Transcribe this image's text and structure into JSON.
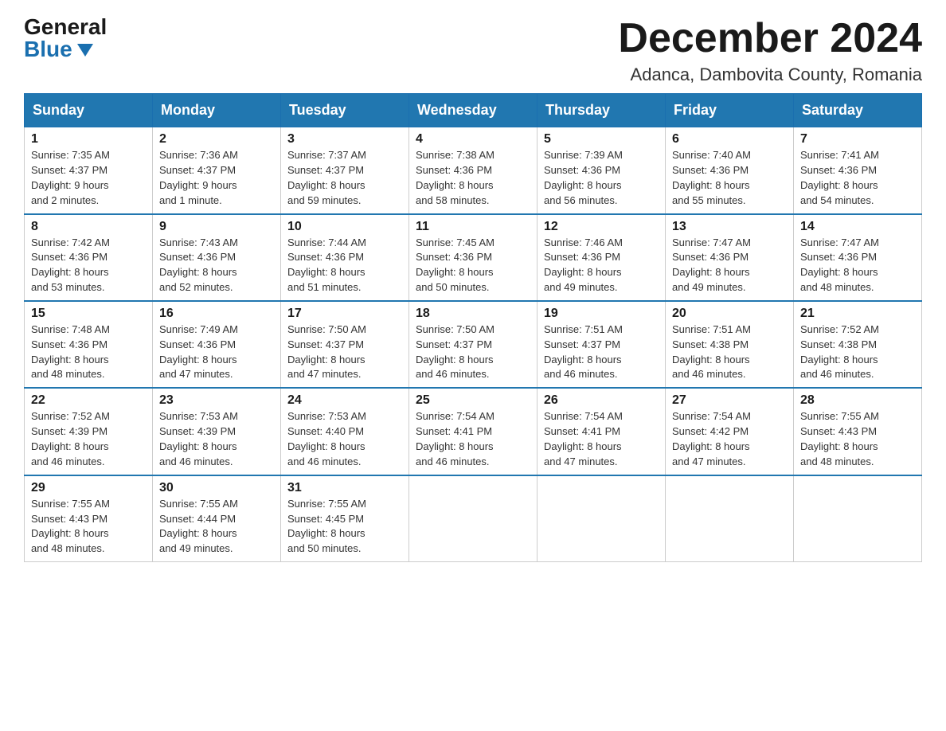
{
  "header": {
    "logo_general": "General",
    "logo_blue": "Blue",
    "month_title": "December 2024",
    "location": "Adanca, Dambovita County, Romania"
  },
  "days_of_week": [
    "Sunday",
    "Monday",
    "Tuesday",
    "Wednesday",
    "Thursday",
    "Friday",
    "Saturday"
  ],
  "weeks": [
    [
      {
        "day": "1",
        "sunrise": "7:35 AM",
        "sunset": "4:37 PM",
        "daylight": "9 hours and 2 minutes."
      },
      {
        "day": "2",
        "sunrise": "7:36 AM",
        "sunset": "4:37 PM",
        "daylight": "9 hours and 1 minute."
      },
      {
        "day": "3",
        "sunrise": "7:37 AM",
        "sunset": "4:37 PM",
        "daylight": "8 hours and 59 minutes."
      },
      {
        "day": "4",
        "sunrise": "7:38 AM",
        "sunset": "4:36 PM",
        "daylight": "8 hours and 58 minutes."
      },
      {
        "day": "5",
        "sunrise": "7:39 AM",
        "sunset": "4:36 PM",
        "daylight": "8 hours and 56 minutes."
      },
      {
        "day": "6",
        "sunrise": "7:40 AM",
        "sunset": "4:36 PM",
        "daylight": "8 hours and 55 minutes."
      },
      {
        "day": "7",
        "sunrise": "7:41 AM",
        "sunset": "4:36 PM",
        "daylight": "8 hours and 54 minutes."
      }
    ],
    [
      {
        "day": "8",
        "sunrise": "7:42 AM",
        "sunset": "4:36 PM",
        "daylight": "8 hours and 53 minutes."
      },
      {
        "day": "9",
        "sunrise": "7:43 AM",
        "sunset": "4:36 PM",
        "daylight": "8 hours and 52 minutes."
      },
      {
        "day": "10",
        "sunrise": "7:44 AM",
        "sunset": "4:36 PM",
        "daylight": "8 hours and 51 minutes."
      },
      {
        "day": "11",
        "sunrise": "7:45 AM",
        "sunset": "4:36 PM",
        "daylight": "8 hours and 50 minutes."
      },
      {
        "day": "12",
        "sunrise": "7:46 AM",
        "sunset": "4:36 PM",
        "daylight": "8 hours and 49 minutes."
      },
      {
        "day": "13",
        "sunrise": "7:47 AM",
        "sunset": "4:36 PM",
        "daylight": "8 hours and 49 minutes."
      },
      {
        "day": "14",
        "sunrise": "7:47 AM",
        "sunset": "4:36 PM",
        "daylight": "8 hours and 48 minutes."
      }
    ],
    [
      {
        "day": "15",
        "sunrise": "7:48 AM",
        "sunset": "4:36 PM",
        "daylight": "8 hours and 48 minutes."
      },
      {
        "day": "16",
        "sunrise": "7:49 AM",
        "sunset": "4:36 PM",
        "daylight": "8 hours and 47 minutes."
      },
      {
        "day": "17",
        "sunrise": "7:50 AM",
        "sunset": "4:37 PM",
        "daylight": "8 hours and 47 minutes."
      },
      {
        "day": "18",
        "sunrise": "7:50 AM",
        "sunset": "4:37 PM",
        "daylight": "8 hours and 46 minutes."
      },
      {
        "day": "19",
        "sunrise": "7:51 AM",
        "sunset": "4:37 PM",
        "daylight": "8 hours and 46 minutes."
      },
      {
        "day": "20",
        "sunrise": "7:51 AM",
        "sunset": "4:38 PM",
        "daylight": "8 hours and 46 minutes."
      },
      {
        "day": "21",
        "sunrise": "7:52 AM",
        "sunset": "4:38 PM",
        "daylight": "8 hours and 46 minutes."
      }
    ],
    [
      {
        "day": "22",
        "sunrise": "7:52 AM",
        "sunset": "4:39 PM",
        "daylight": "8 hours and 46 minutes."
      },
      {
        "day": "23",
        "sunrise": "7:53 AM",
        "sunset": "4:39 PM",
        "daylight": "8 hours and 46 minutes."
      },
      {
        "day": "24",
        "sunrise": "7:53 AM",
        "sunset": "4:40 PM",
        "daylight": "8 hours and 46 minutes."
      },
      {
        "day": "25",
        "sunrise": "7:54 AM",
        "sunset": "4:41 PM",
        "daylight": "8 hours and 46 minutes."
      },
      {
        "day": "26",
        "sunrise": "7:54 AM",
        "sunset": "4:41 PM",
        "daylight": "8 hours and 47 minutes."
      },
      {
        "day": "27",
        "sunrise": "7:54 AM",
        "sunset": "4:42 PM",
        "daylight": "8 hours and 47 minutes."
      },
      {
        "day": "28",
        "sunrise": "7:55 AM",
        "sunset": "4:43 PM",
        "daylight": "8 hours and 48 minutes."
      }
    ],
    [
      {
        "day": "29",
        "sunrise": "7:55 AM",
        "sunset": "4:43 PM",
        "daylight": "8 hours and 48 minutes."
      },
      {
        "day": "30",
        "sunrise": "7:55 AM",
        "sunset": "4:44 PM",
        "daylight": "8 hours and 49 minutes."
      },
      {
        "day": "31",
        "sunrise": "7:55 AM",
        "sunset": "4:45 PM",
        "daylight": "8 hours and 50 minutes."
      },
      null,
      null,
      null,
      null
    ]
  ],
  "labels": {
    "sunrise": "Sunrise:",
    "sunset": "Sunset:",
    "daylight": "Daylight:"
  }
}
